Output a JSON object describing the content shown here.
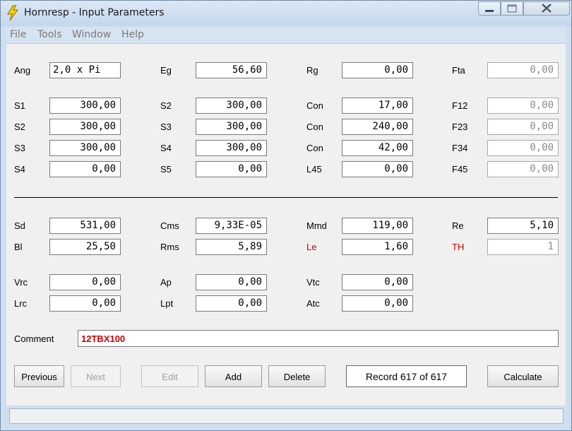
{
  "window": {
    "title": "Hornresp - Input Parameters"
  },
  "menu": {
    "file": "File",
    "tools": "Tools",
    "window": "Window",
    "help": "Help"
  },
  "horn": {
    "ang_label": "Ang",
    "ang_value": "2,0 x Pi",
    "eg_label": "Eg",
    "eg_value": "56,60",
    "rg_label": "Rg",
    "rg_value": "0,00",
    "fta_label": "Fta",
    "fta_value": "0,00",
    "rows": [
      {
        "s_label": "S1",
        "s_value": "300,00",
        "s2_label": "S2",
        "s2_value": "300,00",
        "c_label": "Con",
        "c_value": "17,00",
        "f_label": "F12",
        "f_value": "0,00"
      },
      {
        "s_label": "S2",
        "s_value": "300,00",
        "s2_label": "S3",
        "s2_value": "300,00",
        "c_label": "Con",
        "c_value": "240,00",
        "f_label": "F23",
        "f_value": "0,00"
      },
      {
        "s_label": "S3",
        "s_value": "300,00",
        "s2_label": "S4",
        "s2_value": "300,00",
        "c_label": "Con",
        "c_value": "42,00",
        "f_label": "F34",
        "f_value": "0,00"
      },
      {
        "s_label": "S4",
        "s_value": "0,00",
        "s2_label": "S5",
        "s2_value": "0,00",
        "c_label": "L45",
        "c_value": "0,00",
        "f_label": "F45",
        "f_value": "0,00"
      }
    ]
  },
  "driver": {
    "sd_label": "Sd",
    "sd_value": "531,00",
    "cms_label": "Cms",
    "cms_value": "9,33E-05",
    "mmd_label": "Mmd",
    "mmd_value": "119,00",
    "re_label": "Re",
    "re_value": "5,10",
    "bl_label": "Bl",
    "bl_value": "25,50",
    "rms_label": "Rms",
    "rms_value": "5,89",
    "le_label": "Le",
    "le_value": "1,60",
    "th_label": "TH",
    "th_value": "1"
  },
  "chamber": {
    "vrc_label": "Vrc",
    "vrc_value": "0,00",
    "ap_label": "Ap",
    "ap_value": "0,00",
    "vtc_label": "Vtc",
    "vtc_value": "0,00",
    "lrc_label": "Lrc",
    "lrc_value": "0,00",
    "lpt_label": "Lpt",
    "lpt_value": "0,00",
    "atc_label": "Atc",
    "atc_value": "0,00"
  },
  "comment": {
    "label": "Comment",
    "value": "12TBX100"
  },
  "buttons": {
    "previous": "Previous",
    "next": "Next",
    "edit": "Edit",
    "add": "Add",
    "delete": "Delete",
    "calculate": "Calculate"
  },
  "record": "Record 617 of 617",
  "colors": {
    "label_red": "#cc0000",
    "title_bg": "#cfdff0"
  }
}
